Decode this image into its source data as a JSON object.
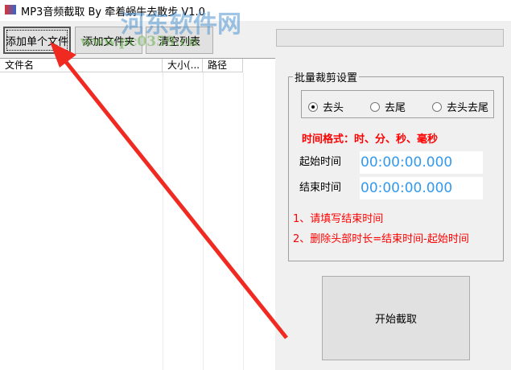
{
  "window": {
    "title": "MP3音频截取 By 牵着蜗牛去散步 V1.0"
  },
  "toolbar": {
    "add_file": "添加单个文件",
    "add_folder": "添加文件夹",
    "clear_list": "清空列表"
  },
  "list": {
    "columns": [
      "文件名",
      "大小(...",
      "路径"
    ]
  },
  "settings": {
    "group_title": "批量裁剪设置",
    "modes": [
      {
        "label": "去头",
        "selected": true
      },
      {
        "label": "去尾",
        "selected": false
      },
      {
        "label": "去头去尾",
        "selected": false
      }
    ],
    "format_hint": "时间格式：时、分、秒、毫秒",
    "start_label": "起始时间",
    "start_value": "00:00:00.000",
    "end_label": "结束时间",
    "end_value": "00:00:00.000",
    "note1": "1、请填写结束时间",
    "note2": "2、删除头部时长=结束时间-起始时间"
  },
  "start_button": "开始截取",
  "watermark": {
    "text": "河东软件网",
    "url": "www.pc0359.cn"
  }
}
